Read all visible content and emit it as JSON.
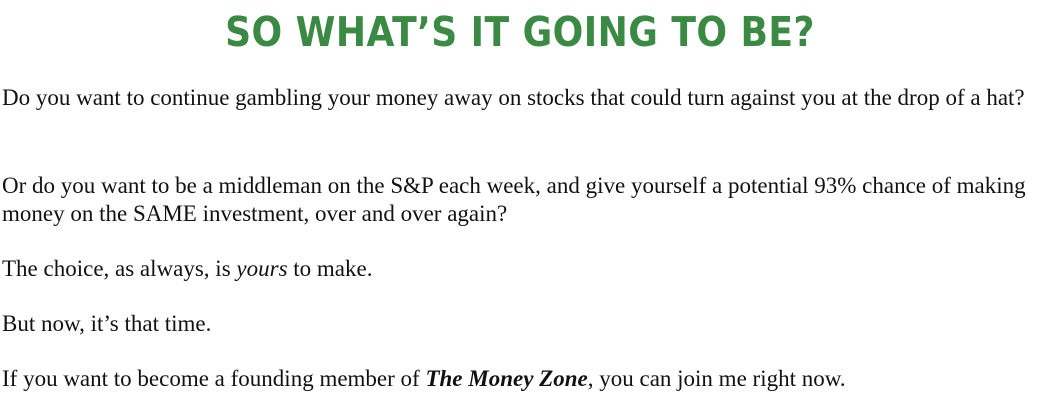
{
  "heading": "SO WHAT’S IT GOING TO BE?",
  "paragraphs": {
    "p1": "Do you want to continue gambling your money away on stocks that could turn against you at the drop of a hat?",
    "p2": "Or do you want to be a middleman on the S&P each week, and give yourself a potential 93% chance of making money on the SAME investment, over and over again?",
    "p3": {
      "before": "The choice, as always, is ",
      "emphasis": "yours",
      "after": " to make."
    },
    "p4": "But now, it’s that time.",
    "p5": {
      "before": "If you want to become a founding member of ",
      "emphasis": "The Money Zone",
      "after": ", you can join me right now."
    }
  },
  "colors": {
    "heading": "#3a8a43",
    "body_text": "#111111",
    "background": "#ffffff"
  }
}
